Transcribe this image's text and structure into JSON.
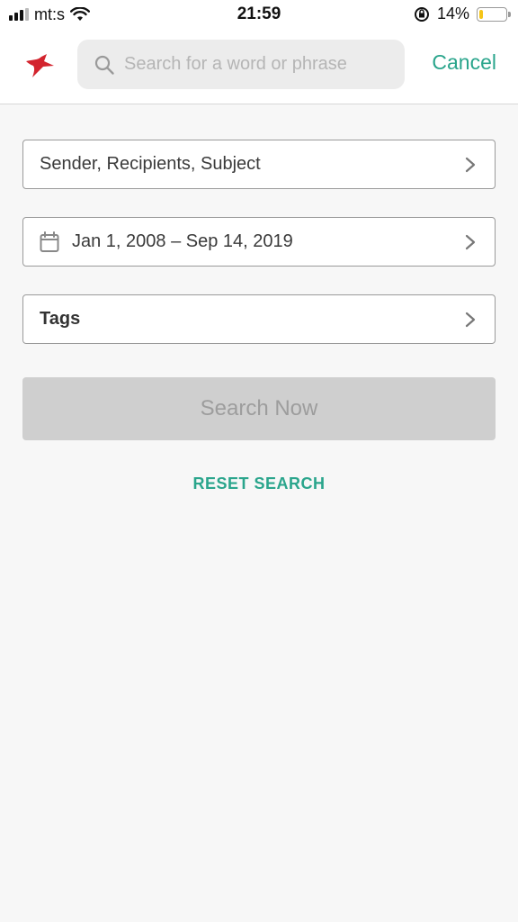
{
  "status_bar": {
    "carrier": "mt:s",
    "time": "21:59",
    "battery_percent": "14%",
    "battery_level": 0.14,
    "icons": [
      "signal-icon",
      "wifi-icon",
      "rotation-lock-icon",
      "battery-icon"
    ]
  },
  "header": {
    "logo_icon": "app-logo-icon",
    "search": {
      "placeholder": "Search for a word or phrase",
      "value": ""
    },
    "cancel_label": "Cancel"
  },
  "filters": {
    "people_label": "Sender, Recipients, Subject",
    "date_range_label": "Jan 1, 2008 – Sep 14, 2019",
    "tags_label": "Tags"
  },
  "actions": {
    "search_now_label": "Search Now",
    "reset_label": "RESET SEARCH"
  },
  "colors": {
    "accent": "#2aa58c",
    "logo": "#d3242e",
    "background": "#f7f7f7",
    "disabled_button": "#cfcfcf"
  }
}
